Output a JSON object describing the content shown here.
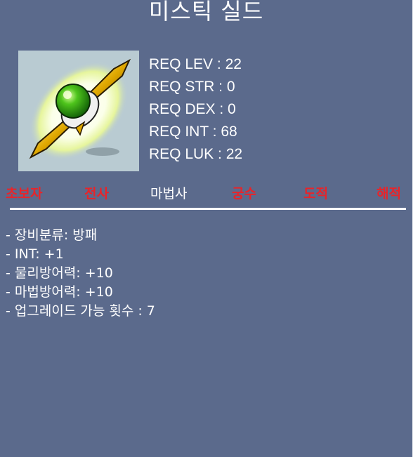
{
  "title": "미스틱 실드",
  "item": {
    "icon": "mystic-shield-icon"
  },
  "requirements": [
    {
      "label": "REQ LEV",
      "value": "22"
    },
    {
      "label": "REQ STR",
      "value": "0"
    },
    {
      "label": "REQ DEX",
      "value": "0"
    },
    {
      "label": "REQ INT",
      "value": "68"
    },
    {
      "label": "REQ LUK",
      "value": "22"
    }
  ],
  "jobs": [
    {
      "name": "초보자",
      "color": "#e8242a"
    },
    {
      "name": "전사",
      "color": "#e8242a"
    },
    {
      "name": "마법사",
      "color": "#ffffff"
    },
    {
      "name": "궁수",
      "color": "#e8242a"
    },
    {
      "name": "도적",
      "color": "#e8242a"
    },
    {
      "name": "해적",
      "color": "#e8242a"
    }
  ],
  "stats": [
    "- 장비분류: 방패",
    "- INT: +1",
    "- 물리방어력: +10",
    "- 마법방어력: +10",
    "- 업그레이드 가능 횟수 : 7"
  ],
  "colors": {
    "panel_bg": "#5b6a8c",
    "item_bg": "#b9cbd2",
    "restricted_job": "#e8242a",
    "allowed_job": "#ffffff"
  }
}
